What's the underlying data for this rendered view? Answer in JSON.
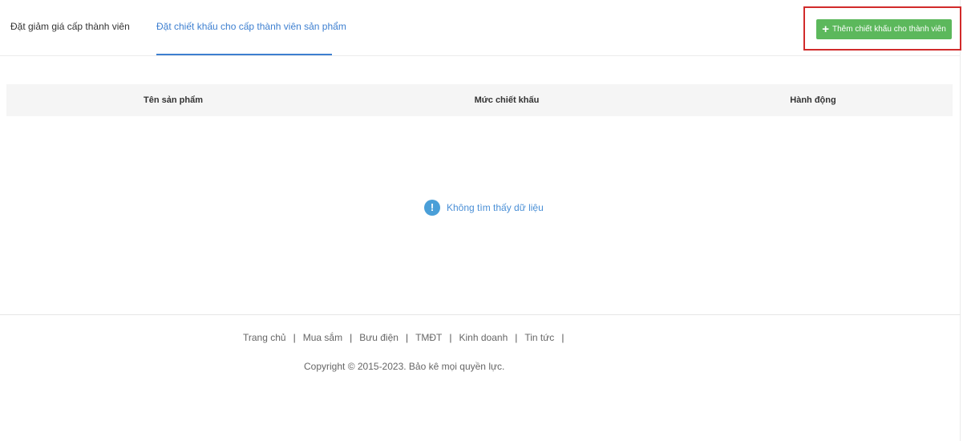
{
  "tabs": [
    {
      "label": "Đặt giảm giá cấp thành viên",
      "active": false
    },
    {
      "label": "Đặt chiết khấu cho cấp thành viên sản phẩm",
      "active": true
    }
  ],
  "toolbar": {
    "add_label": "Thêm chiết khấu cho thành viên",
    "add_icon": "plus-icon",
    "highlight_color": "#d12b2b",
    "button_color": "#5cb85c"
  },
  "table": {
    "columns": [
      "Tên sản phẩm",
      "Mức chiết khấu",
      "Hành động"
    ],
    "rows": [],
    "empty_message": "Không tìm thấy dữ liệu",
    "empty_icon": "info-icon"
  },
  "footer": {
    "links": [
      "Trang chủ",
      "Mua sắm",
      "Bưu điện",
      "TMĐT",
      "Kinh doanh",
      "Tin tức"
    ],
    "copyright": "Copyright © 2015-2023. Bảo kê mọi quyền lực."
  },
  "colors": {
    "accent": "#3d7fd0",
    "empty_text": "#4a8fd6"
  }
}
